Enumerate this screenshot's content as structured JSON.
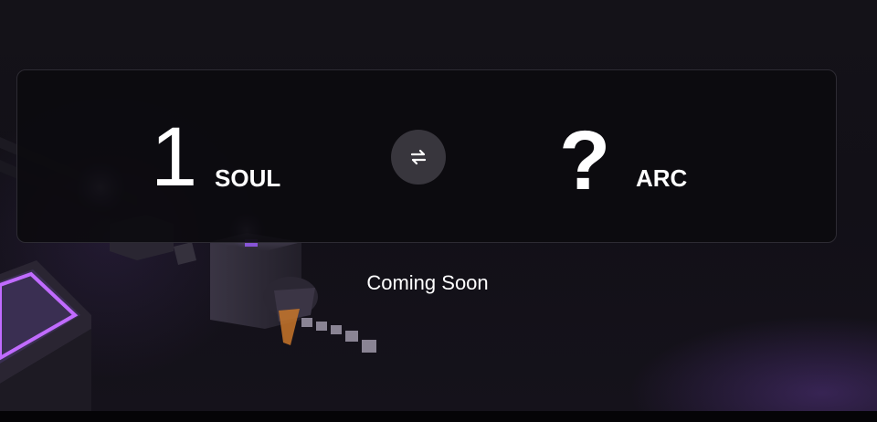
{
  "swap": {
    "from_amount": "1",
    "from_token": "SOUL",
    "to_amount": "?",
    "to_token": "ARC",
    "swap_icon": "swap-arrows-icon"
  },
  "status": {
    "text": "Coming Soon"
  },
  "colors": {
    "background": "#121017",
    "panel": "#0c0b0f",
    "panel_border": "#2d2b33",
    "swap_button": "#38363d",
    "accent": "#a063ff"
  }
}
